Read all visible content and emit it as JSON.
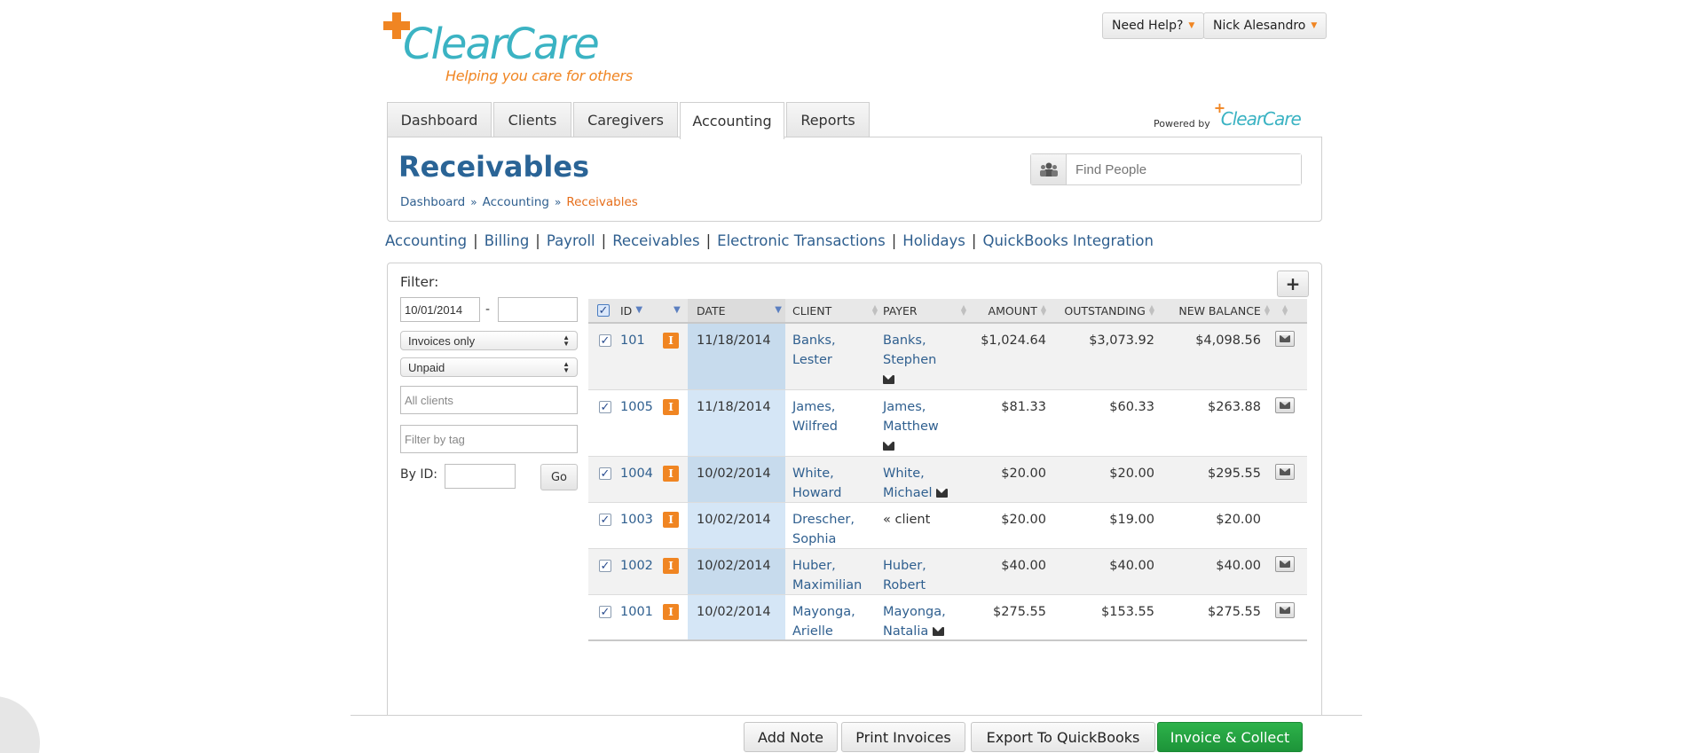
{
  "app": {
    "logo_text": "ClearCare",
    "tagline": "Helping you care for others",
    "powered_by": "Powered by",
    "powered_logo": "ClearCare"
  },
  "top_menu": {
    "help_label": "Need Help?",
    "user_label": "Nick Alesandro"
  },
  "tabs": [
    {
      "label": "Dashboard"
    },
    {
      "label": "Clients"
    },
    {
      "label": "Caregivers"
    },
    {
      "label": "Accounting"
    },
    {
      "label": "Reports"
    }
  ],
  "header": {
    "title": "Receivables",
    "breadcrumb": [
      "Dashboard",
      "Accounting",
      "Receivables"
    ],
    "search_placeholder": "Find People"
  },
  "subnav": [
    "Accounting",
    "Billing",
    "Payroll",
    "Receivables",
    "Electronic Transactions",
    "Holidays",
    "QuickBooks Integration"
  ],
  "filter": {
    "label": "Filter:",
    "date_from": "10/01/2014",
    "date_sep": "-",
    "date_to": "",
    "type_select": "Invoices only",
    "status_select": "Unpaid",
    "clients_placeholder": "All clients",
    "tag_placeholder": "Filter by tag",
    "by_id_label": "By ID:",
    "go_label": "Go"
  },
  "table": {
    "headers": {
      "id": "ID",
      "date": "DATE",
      "client": "CLIENT",
      "payer": "PAYER",
      "amount": "AMOUNT",
      "outstanding": "OUTSTANDING",
      "new_balance": "NEW BALANCE"
    },
    "rows": [
      {
        "id": "101",
        "date": "11/18/2014",
        "client1": "Banks,",
        "client2": "Lester",
        "payer1": "Banks,",
        "payer2": "Stephen",
        "amount": "$1,024.64",
        "outstanding": "$3,073.92",
        "new_balance": "$4,098.56"
      },
      {
        "id": "1005",
        "date": "11/18/2014",
        "client1": "James,",
        "client2": "Wilfred",
        "payer1": "James,",
        "payer2": "Matthew",
        "amount": "$81.33",
        "outstanding": "$60.33",
        "new_balance": "$263.88"
      },
      {
        "id": "1004",
        "date": "10/02/2014",
        "client1": "White,",
        "client2": "Howard",
        "payer1": "White,",
        "payer2": "Michael",
        "amount": "$20.00",
        "outstanding": "$20.00",
        "new_balance": "$295.55"
      },
      {
        "id": "1003",
        "date": "10/02/2014",
        "client1": "Drescher,",
        "client2": "Sophia",
        "payer1": "« client",
        "payer2": "",
        "amount": "$20.00",
        "outstanding": "$19.00",
        "new_balance": "$20.00"
      },
      {
        "id": "1002",
        "date": "10/02/2014",
        "client1": "Huber,",
        "client2": "Maximilian",
        "payer1": "Huber,",
        "payer2": "Robert",
        "amount": "$40.00",
        "outstanding": "$40.00",
        "new_balance": "$40.00"
      },
      {
        "id": "1001",
        "date": "10/02/2014",
        "client1": "Mayonga,",
        "client2": "Arielle",
        "payer1": "Mayonga,",
        "payer2": "Natalia",
        "amount": "$275.55",
        "outstanding": "$153.55",
        "new_balance": "$275.55"
      }
    ]
  },
  "actions": {
    "add_note": "Add Note",
    "print_invoices": "Print Invoices",
    "export_quickbooks": "Export To QuickBooks",
    "invoice_collect": "Invoice & Collect"
  },
  "colors": {
    "brand_teal": "#3bb3c3",
    "brand_orange": "#f08522",
    "link_blue": "#2f5f8f",
    "title_blue": "#2a6496",
    "primary_green": "#1d9439"
  }
}
